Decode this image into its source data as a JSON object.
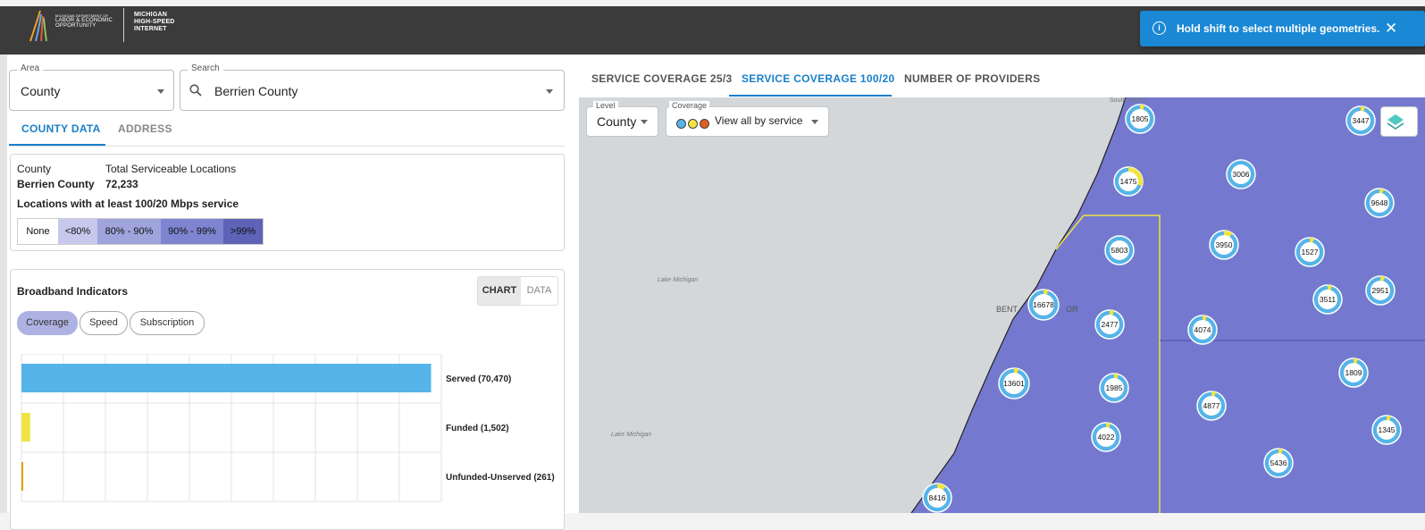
{
  "header": {
    "logo_lines": [
      "MICHIGAN DEPARTMENT OF",
      "LABOR & ECONOMIC",
      "OPPORTUNITY"
    ],
    "program_lines": [
      "MICHIGAN",
      "HIGH-SPEED",
      "INTERNET"
    ]
  },
  "toast": {
    "message": "Hold shift to select multiple geometries.",
    "close": "✕",
    "info": "i"
  },
  "filters": {
    "area": {
      "label": "Area",
      "value": "County"
    },
    "search": {
      "label": "Search",
      "value": "Berrien County"
    }
  },
  "left_tabs": [
    {
      "label": "COUNTY DATA",
      "active": true
    },
    {
      "label": "ADDRESS",
      "active": false
    }
  ],
  "county_card": {
    "county_header": "County",
    "locations_header": "Total Serviceable Locations",
    "county_value": "Berrien County",
    "locations_value": "72,233",
    "service_title": "Locations with at least 100/20 Mbps service",
    "legend": [
      {
        "label": "None",
        "color": "#ffffff"
      },
      {
        "label": "<80%",
        "color": "#c6c9ec"
      },
      {
        "label": "80% - 90%",
        "color": "#9fa4dc"
      },
      {
        "label": "90% - 99%",
        "color": "#7e84cf"
      },
      {
        "label": ">99%",
        "color": "#5e63b8"
      }
    ]
  },
  "indicators": {
    "title": "Broadband Indicators",
    "toggle": [
      "CHART",
      "DATA"
    ],
    "pills": [
      "Coverage",
      "Speed",
      "Subscription"
    ]
  },
  "chart_data": {
    "type": "bar",
    "orientation": "horizontal",
    "categories": [
      "Served (70,470)",
      "Funded (1,502)",
      "Unfunded-Unserved (261)"
    ],
    "values": [
      70470,
      1502,
      261
    ],
    "colors": [
      "#56b4e9",
      "#f0e442",
      "#e69f00"
    ],
    "xlim": [
      0,
      72233
    ],
    "grid": true
  },
  "map": {
    "tabs": [
      {
        "label": "SERVICE COVERAGE 25/3",
        "active": false
      },
      {
        "label": "SERVICE COVERAGE 100/20",
        "active": true
      },
      {
        "label": "NUMBER OF PROVIDERS",
        "active": false
      }
    ],
    "level": {
      "label": "Level",
      "value": "County"
    },
    "coverage": {
      "label": "Coverage",
      "value": "View all by service",
      "dot_colors": [
        "#56b4e9",
        "#f0e442",
        "#e06020"
      ]
    },
    "place_labels": [
      "Lake Michigan",
      "Lake Michigan",
      "BENT",
      "OR",
      "South Haven"
    ],
    "clusters": [
      {
        "label": "1805",
        "funded": 0.05
      },
      {
        "label": "3447",
        "funded": 0.05
      },
      {
        "label": "1475",
        "funded": 0.3
      },
      {
        "label": "3006",
        "funded": 0.0
      },
      {
        "label": "9648",
        "funded": 0.05
      },
      {
        "label": "5803",
        "funded": 0.0
      },
      {
        "label": "3950",
        "funded": 0.1
      },
      {
        "label": "1527",
        "funded": 0.05
      },
      {
        "label": "2951",
        "funded": 0.05
      },
      {
        "label": "3511",
        "funded": 0.05
      },
      {
        "label": "16678",
        "funded": 0.05
      },
      {
        "label": "2477",
        "funded": 0.05
      },
      {
        "label": "4074",
        "funded": 0.05
      },
      {
        "label": "1809",
        "funded": 0.05
      },
      {
        "label": "13601",
        "funded": 0.05
      },
      {
        "label": "1985",
        "funded": 0.05
      },
      {
        "label": "4877",
        "funded": 0.05
      },
      {
        "label": "1345",
        "funded": 0.05
      },
      {
        "label": "4022",
        "funded": 0.05
      },
      {
        "label": "5436",
        "funded": 0.05
      },
      {
        "label": "8416",
        "funded": 0.1
      }
    ]
  }
}
